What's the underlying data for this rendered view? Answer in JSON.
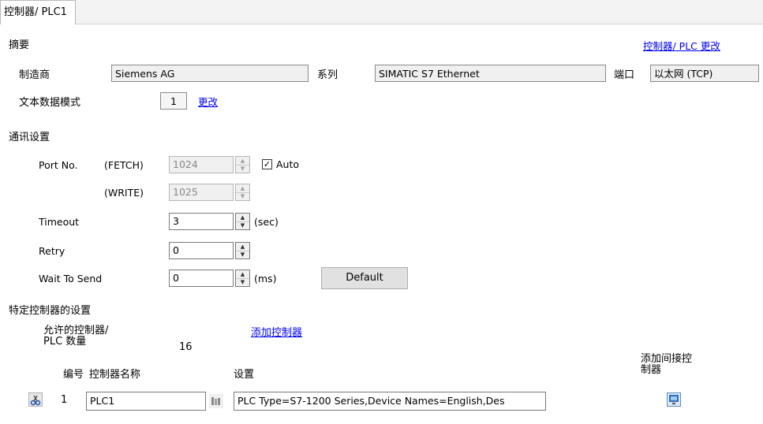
{
  "tab": {
    "label": "控制器/ PLC1"
  },
  "summary": {
    "heading": "摘要",
    "change_link": "控制器/ PLC 更改",
    "manufacturer_label": "制造商",
    "manufacturer_value": "Siemens AG",
    "series_label": "系列",
    "series_value": "SIMATIC S7 Ethernet",
    "port_label": "端口",
    "port_value": "以太网 (TCP)",
    "text_mode_label": "文本数据模式",
    "text_mode_value": "1",
    "text_mode_change": "更改"
  },
  "comm": {
    "heading": "通讯设置",
    "port_no_label": "Port No.",
    "fetch_label": "(FETCH)",
    "fetch_value": "1024",
    "auto_label": "Auto",
    "auto_checked": true,
    "write_label": "(WRITE)",
    "write_value": "1025",
    "timeout_label": "Timeout",
    "timeout_value": "3",
    "timeout_unit": "(sec)",
    "retry_label": "Retry",
    "retry_value": "0",
    "wait_label": "Wait To Send",
    "wait_value": "0",
    "wait_unit": "(ms)",
    "default_button": "Default"
  },
  "specific": {
    "heading": "特定控制器的设置",
    "allowed_label_1": "允许的控制器/",
    "allowed_label_2": "PLC 数量",
    "allowed_count": "16",
    "add_controller": "添加控制器",
    "col_no": "编号",
    "col_name": "控制器名称",
    "col_settings": "设置",
    "col_add_indirect_1": "添加间接控",
    "col_add_indirect_2": "制器",
    "rows": [
      {
        "no": "1",
        "name": "PLC1",
        "settings": "PLC Type=S7-1200 Series,Device Names=English,Des"
      }
    ]
  },
  "colors": {
    "link": "#0000ee",
    "readonly_bg": "#f0f0f0"
  }
}
